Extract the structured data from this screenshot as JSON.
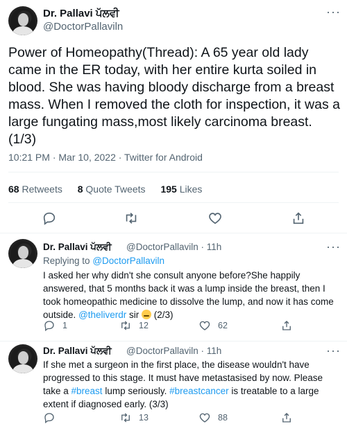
{
  "main": {
    "author_name": "Dr. Pallavi ਪੱਲਵੀ",
    "author_handle": "@DoctorPallaviln",
    "text": "Power of Homeopathy(Thread): A 65 year old lady came in the ER today, with her entire kurta soiled in blood. She was having bloody discharge from a breast mass. When I removed the cloth for inspection, it was a large fungating mass,most likely carcinoma breast. (1/3)",
    "timestamp": "10:21 PM · Mar 10, 2022 · Twitter for Android",
    "retweets_count": "68",
    "retweets_label": "Retweets",
    "quotes_count": "8",
    "quotes_label": "Quote Tweets",
    "likes_count": "195",
    "likes_label": "Likes"
  },
  "reply1": {
    "author_name": "Dr. Pallavi ਪੱਲਵੀ",
    "meta": "@DoctorPallaviln · 11h",
    "replying_prefix": "Replying to",
    "replying_handle": "@DoctorPallaviln",
    "text": "I asked her why didn't she consult anyone before?She happily answered, that 5 months back it was a lump inside the breast, then I took homeopathic medicine to dissolve the lump, and now it has come outside.",
    "mention": "@theliverdr",
    "after_mention": " sir ",
    "suffix": " (2/3)",
    "reply_count": "1",
    "retweet_count": "12",
    "like_count": "62"
  },
  "reply2": {
    "author_name": "Dr. Pallavi ਪੱਲਵੀ",
    "meta": "@DoctorPallaviln · 11h",
    "text_part1": "If she met a surgeon in the first place, the disease wouldn't have progressed to this stage. It must have metastasised by now. Please take a ",
    "hashtag1": "#breast",
    "text_part2": " lump seriously. ",
    "hashtag2": "#breastcancer",
    "text_part3": " is treatable to a large extent if diagnosed early. (3/3)",
    "retweet_count": "13",
    "like_count": "88"
  },
  "colors": {
    "link": "#1d9bf0",
    "secondary_text": "#536471",
    "primary_text": "#0f1419"
  },
  "icons": [
    "reply-icon",
    "retweet-icon",
    "like-icon",
    "share-icon",
    "more-icon",
    "sweat-smile-emoji"
  ]
}
